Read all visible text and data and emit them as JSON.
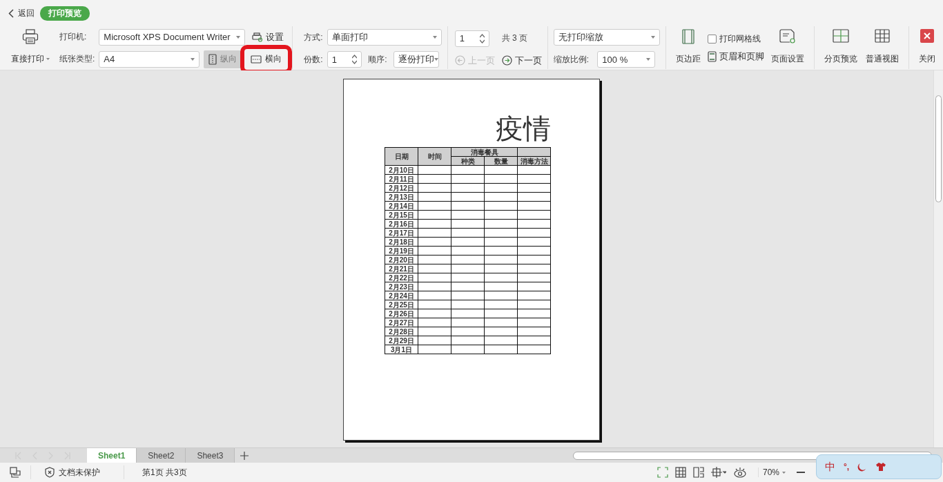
{
  "header": {
    "back": "返回",
    "mode_badge": "打印预览"
  },
  "toolbar": {
    "direct_print": "直接打印",
    "printer_label": "打印机:",
    "printer": "Microsoft XPS Document Writer",
    "settings": "设置",
    "paper_label": "纸张类型:",
    "paper": "A4",
    "orientations": [
      {
        "kind": "portrait",
        "label": "纵向",
        "selected": true,
        "highlighted": false
      },
      {
        "kind": "landscape",
        "label": "横向",
        "selected": false,
        "highlighted": true
      }
    ],
    "mode_label": "方式:",
    "mode": "单面打印",
    "copies_label": "份数:",
    "copies": "1",
    "order_label": "顺序:",
    "order": "逐份打印",
    "page_field": "1",
    "page_total": "共 3 页",
    "prev": {
      "label": "上一页",
      "disabled": true
    },
    "next": {
      "label": "下一页",
      "disabled": false
    },
    "scaling": "无打印缩放",
    "zoom_label": "缩放比例:",
    "zoom": "100 %",
    "margins": "页边距",
    "gridlines": {
      "label": "打印网格线",
      "checked": false
    },
    "header_footer": "页眉和页脚",
    "page_setup": "页面设置",
    "page_break_preview": "分页预览",
    "normal_view": "普通视图",
    "close": "关闭"
  },
  "preview": {
    "title": "疫情",
    "headers": {
      "date": "日期",
      "time": "时间",
      "group": "消毒餐具",
      "kind": "种类",
      "quantity": "数量",
      "method": "消毒方法"
    },
    "rows": [
      "2月10日",
      "2月11日",
      "2月12日",
      "2月13日",
      "2月14日",
      "2月15日",
      "2月16日",
      "2月17日",
      "2月18日",
      "2月19日",
      "2月20日",
      "2月21日",
      "2月22日",
      "2月23日",
      "2月24日",
      "2月25日",
      "2月26日",
      "2月27日",
      "2月28日",
      "2月29日",
      "3月1日"
    ]
  },
  "sheet_tabs": [
    {
      "label": "Sheet1",
      "selected": true
    },
    {
      "label": "Sheet2",
      "selected": false
    },
    {
      "label": "Sheet3",
      "selected": false
    }
  ],
  "status_bar": {
    "protection": "文档未保护",
    "page_info": "第1页 共3页",
    "zoom": "70%"
  },
  "ime": {
    "mode": "中",
    "punct": "°,"
  }
}
